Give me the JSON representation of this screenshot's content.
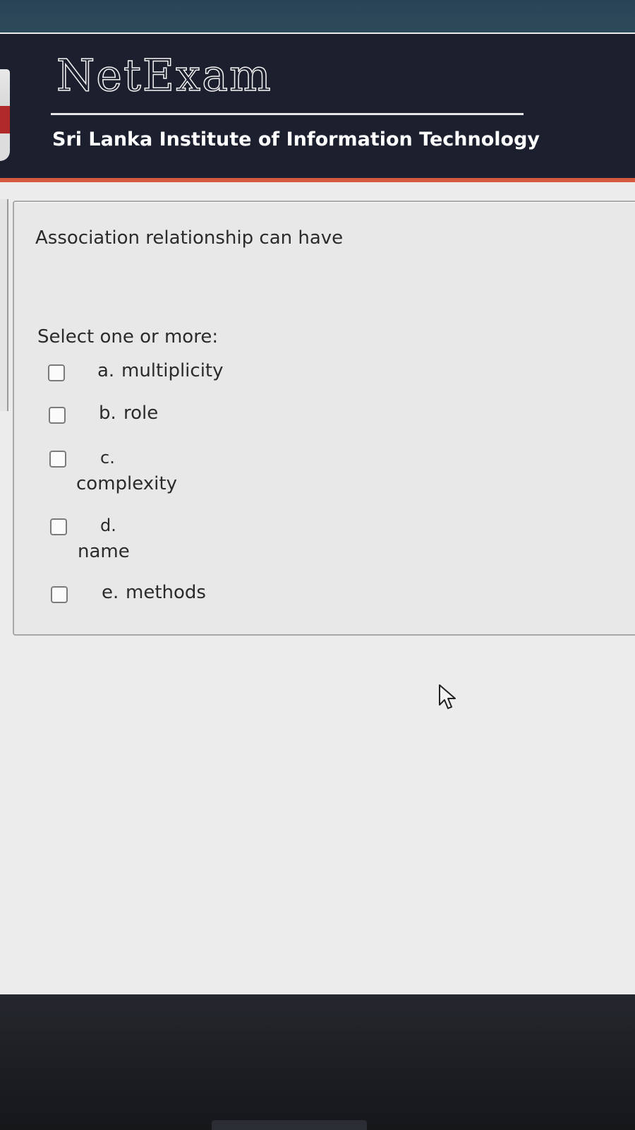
{
  "header": {
    "brand": "NetExam",
    "institute": "Sri Lanka Institute of Information Technology"
  },
  "question": {
    "text": "Association relationship can have",
    "prompt": "Select one or more:",
    "options": [
      {
        "letter": "a.",
        "label": "multiplicity",
        "checked": false
      },
      {
        "letter": "b.",
        "label": "role",
        "checked": false
      },
      {
        "letter": "c.",
        "label": "complexity",
        "checked": false
      },
      {
        "letter": "d.",
        "label": "name",
        "checked": false
      },
      {
        "letter": "e.",
        "label": "methods",
        "checked": false
      }
    ]
  },
  "colors": {
    "header_bg": "#1c1f2e",
    "header_accent": "#d4593f",
    "card_bg": "#e8e8e8",
    "text": "#2b2b2b"
  },
  "icons": {
    "cursor": "mouse-pointer-icon"
  }
}
